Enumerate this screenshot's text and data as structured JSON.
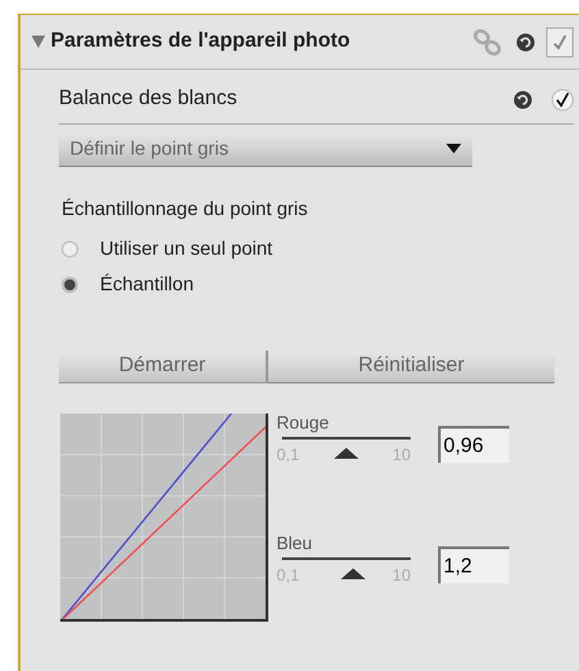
{
  "panel": {
    "title": "Paramètres de l'appareil photo",
    "expanded": true,
    "checkbox": {
      "checked": true
    }
  },
  "section": {
    "title": "Balance des blancs",
    "checked": true
  },
  "dropdown": {
    "value": "Définir le point gris"
  },
  "sampling": {
    "label": "Échantillonnage du point gris",
    "options": [
      {
        "label": "Utiliser un seul point",
        "selected": false
      },
      {
        "label": "Échantillon",
        "selected": true
      }
    ]
  },
  "buttons": [
    "Démarrer",
    "Réinitialiser"
  ],
  "sliders": [
    {
      "name": "Rouge",
      "min": "0,1",
      "max": "10",
      "level": 0.5,
      "value": "0,96"
    },
    {
      "name": "Bleu",
      "min": "0,1",
      "max": "10",
      "level": 0.55,
      "value": "1,2"
    }
  ]
}
